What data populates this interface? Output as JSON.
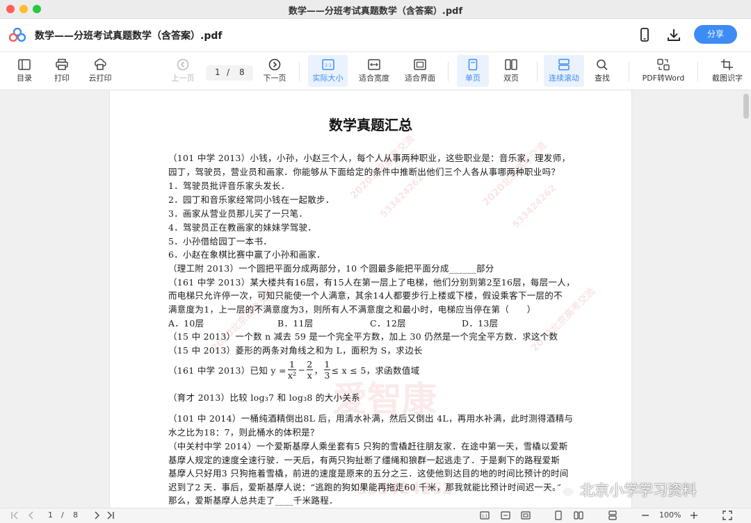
{
  "window": {
    "title": "数学——分班考试真题数学（含答案）.pdf"
  },
  "appbar": {
    "doc_title": "数学——分班考试真题数学（含答案）.pdf",
    "share_label": "分享",
    "accent": "#3d8cf5"
  },
  "toolbar": {
    "toc": "目录",
    "print": "打印",
    "cloud_print": "云打印",
    "prev_page": "上一页",
    "page_current": "1",
    "page_sep": "/",
    "page_total": "8",
    "next_page": "下一页",
    "actual_size": "实际大小",
    "fit_width": "适合宽度",
    "fit_screen": "适合界面",
    "single_page": "单页",
    "double_page": "双页",
    "continuous_scroll": "连续滚动",
    "find": "查找",
    "pdf_to_word": "PDF转Word",
    "ocr": "截图识字"
  },
  "document": {
    "heading": "数学真题汇总",
    "lines": [
      "（101 中学 2013）小钱，小孙，小赵三个人，每个人从事两种职业，这些职业是：音乐家，理发师，",
      "园丁，驾驶员，营业员和画家．你能够从下面给定的条件中推断出他们三个人各从事哪两种职业吗？",
      "1．驾驶员批评音乐家头发长．",
      "2．园丁和音乐家经常同小钱在一起散步．",
      "3．画家从营业员那儿买了一只笔．",
      "4．驾驶员正在教画家的妹妹学驾驶．",
      "5．小孙借给园丁一本书．",
      "6．小赵在象棋比赛中赢了小孙和画家．",
      "（理工附 2013）一个圆把平面分成两部分，10 个圆最多能把平面分成______部分",
      "（161 中学 2013）某大楼共有16层，有15人在第一层上了电梯，他们分别到第2至16层，每层一人，",
      "而电梯只允许停一次，可知只能使一个人满意，其余14人都要步行上楼或下楼，假设乘客下一层的不",
      "满意度为1，上一层的不满意度为3，则所有人不满意度之和最小时，电梯应当停在第（　　）"
    ],
    "options": [
      "A．10层",
      "B．11层",
      "C．12层",
      "D．13层"
    ],
    "lines2": [
      "（15 中 2013）一个数 n 减去 59 是一个完全平方数，加上 30 仍然是一个完全平方数．求这个数",
      "（15 中 2013）菱形的两条对角线之和为 L，面积为 S，求边长"
    ],
    "eq_prefix": "（161 中学 2013）已知 y =",
    "eq_f1_num": "1",
    "eq_f1_den": "x²",
    "eq_minus": "−",
    "eq_f2_num": "2",
    "eq_f2_den": "x",
    "eq_comma": "，",
    "eq_f3_num": "1",
    "eq_f3_den": "3",
    "eq_range": "≤ x ≤ 5，求函数值域",
    "log_line": "（育才 2013）比较 log₃7 和 log₃8 的大小关系",
    "lines3": [
      "（101 中 2014）一桶纯酒精倒出8L 后，用清水补满，然后又倒出 4L，再用水补满，此时测得酒精与",
      "水之比为18：7，则此桶水的体积是？",
      "（中关村中学 2014）一个爱斯基摩人乘坐套有5 只狗的雪橇赶往朋友家．在途中第一天，雪橇以爱斯",
      "基摩人规定的速度全速行驶．一天后，有两只狗扯断了缰绳和狼群一起逃走了．于是剩下的路程爱斯",
      "基摩人只好用3 只狗拖着雪橇，前进的速度是原来的五分之三．这使他到达目的地的时间比预计的时间",
      "迟到了2 天．事后，爱斯基摩人说：“逃跑的狗如果能再拖走60 千米，那我就能比预计时间迟一天。”",
      "那么，爱斯基摩人总共走了____千米路程．"
    ],
    "watermark_brand": "爱智康",
    "watermark_small": "2020北京高考交流",
    "watermark_num": "533424262"
  },
  "overlay": {
    "wechat_label": "北京小学学习资料"
  },
  "bottombar": {
    "page_current": "1",
    "page_sep": "/",
    "page_total": "8",
    "zoom": "100%"
  }
}
